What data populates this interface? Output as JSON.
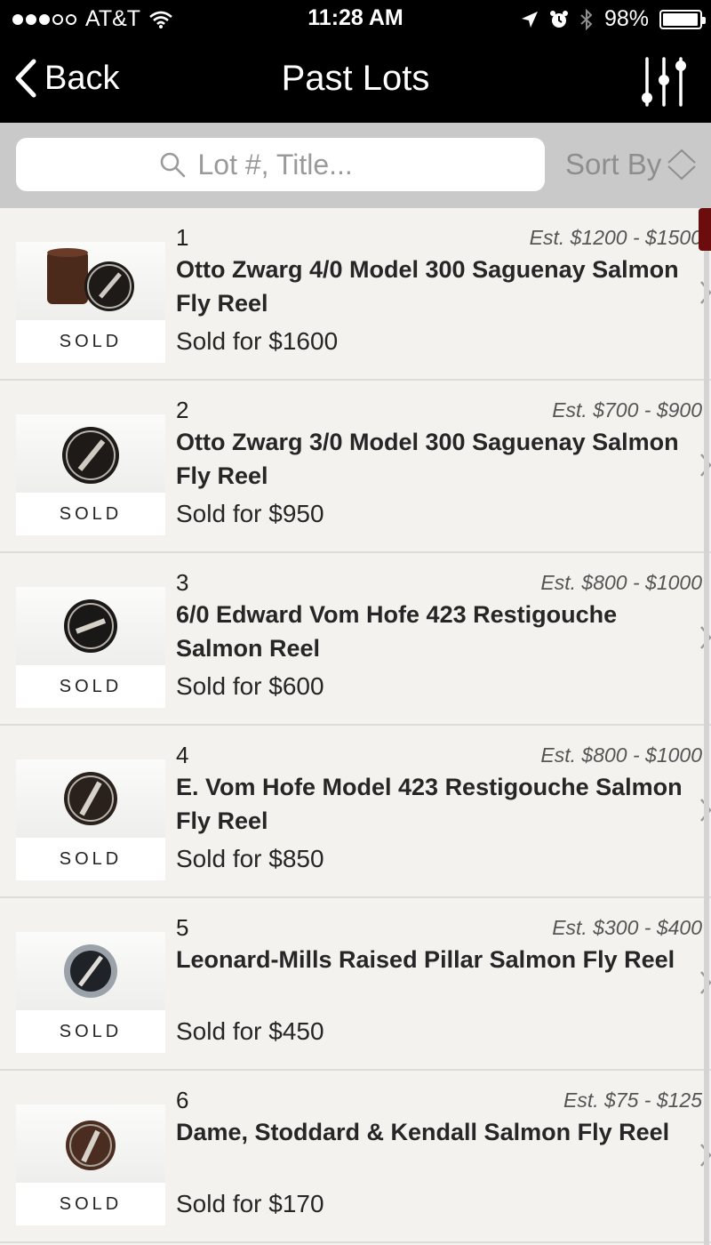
{
  "status_bar": {
    "carrier": "AT&T",
    "time": "11:28 AM",
    "battery_percent": "98%",
    "battery_level": 0.98,
    "icons": [
      "signal-dots-icon",
      "wifi-icon",
      "location-arrow-icon",
      "alarm-icon",
      "bluetooth-icon",
      "battery-icon"
    ]
  },
  "nav": {
    "back_label": "Back",
    "title": "Past Lots",
    "filter_icon": "sliders-icon"
  },
  "search": {
    "placeholder": "Lot #, Title...",
    "value": "",
    "sort_label": "Sort By"
  },
  "lots": [
    {
      "number": "1",
      "estimate": "Est. $1200 - $1500",
      "title": "Otto Zwarg 4/0 Model 300 Saguenay Salmon Fly Reel",
      "status": "SOLD",
      "sold_for": "Sold for $1600"
    },
    {
      "number": "2",
      "estimate": "Est. $700 - $900",
      "title": "Otto Zwarg 3/0 Model 300 Saguenay Salmon Fly Reel",
      "status": "SOLD",
      "sold_for": "Sold for $950"
    },
    {
      "number": "3",
      "estimate": "Est. $800 - $1000",
      "title": "6/0 Edward Vom Hofe 423 Restigouche Salmon Reel",
      "status": "SOLD",
      "sold_for": "Sold for $600"
    },
    {
      "number": "4",
      "estimate": "Est. $800 - $1000",
      "title": "E. Vom Hofe Model 423 Restigouche Salmon Fly Reel",
      "status": "SOLD",
      "sold_for": "Sold for $850"
    },
    {
      "number": "5",
      "estimate": "Est. $300 - $400",
      "title": "Leonard-Mills Raised Pillar Salmon Fly Reel",
      "status": "SOLD",
      "sold_for": "Sold for $450"
    },
    {
      "number": "6",
      "estimate": "Est. $75 - $125",
      "title": "Dame, Stoddard & Kendall Salmon Fly Reel",
      "status": "SOLD",
      "sold_for": "Sold for $170"
    }
  ],
  "colors": {
    "bar_background": "#000000",
    "search_bar_background": "#c9c9c9",
    "list_background": "#f3f2ef",
    "scroll_indicator": "#6b0d0d"
  }
}
